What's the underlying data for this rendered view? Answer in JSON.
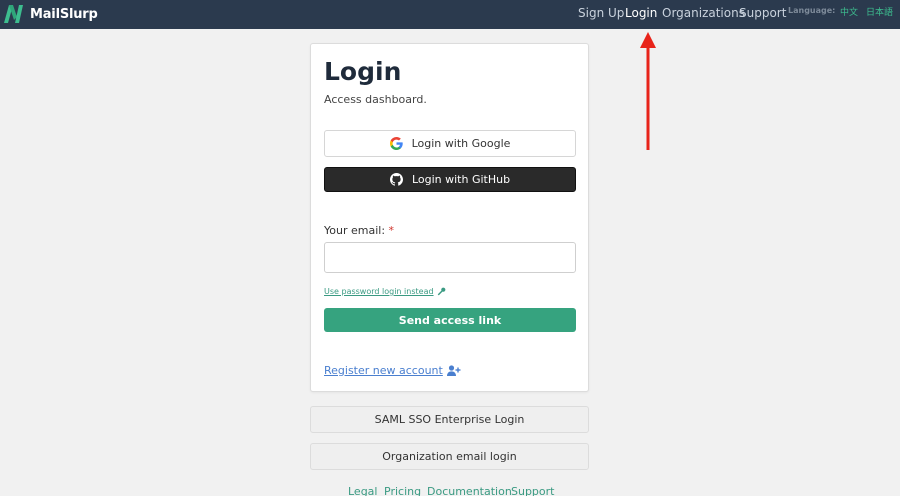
{
  "brand": {
    "name": "MailSlurp"
  },
  "nav": {
    "items": [
      {
        "label": "Sign Up",
        "active": false
      },
      {
        "label": "Login",
        "active": true
      },
      {
        "label": "Organizations",
        "active": false
      },
      {
        "label": "Support",
        "active": false
      }
    ],
    "language_label": "Language:",
    "languages": [
      "中文",
      "日本語"
    ]
  },
  "login": {
    "title": "Login",
    "subtitle": "Access dashboard.",
    "google_button": "Login with Google",
    "github_button": "Login with GitHub",
    "email_label": "Your email:",
    "required_marker": "*",
    "email_value": "",
    "email_placeholder": "",
    "password_link": "Use password login instead",
    "send_button": "Send access link",
    "register_link": "Register new account"
  },
  "alternate": {
    "saml": "SAML SSO Enterprise Login",
    "org": "Organization email login"
  },
  "footer": {
    "links": [
      "Legal",
      "Pricing",
      "Documentation",
      "Support"
    ]
  },
  "annotation": {
    "arrow_color": "#e8231a"
  },
  "colors": {
    "topbar": "#2b3a4e",
    "accent_green": "#36a37f",
    "link_blue": "#4a7fcf",
    "github_dark": "#2a2a2a"
  }
}
